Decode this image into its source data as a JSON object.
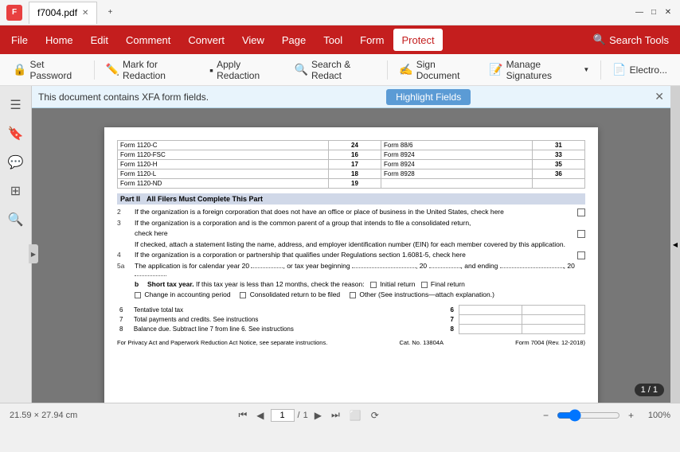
{
  "titlebar": {
    "logo": "F",
    "filename": "f7004.pdf",
    "new_tab": "+",
    "minimize": "—",
    "maximize": "□",
    "close": "✕"
  },
  "menubar": {
    "items": [
      {
        "label": "File",
        "active": false
      },
      {
        "label": "Home",
        "active": false
      },
      {
        "label": "Edit",
        "active": false
      },
      {
        "label": "Comment",
        "active": false
      },
      {
        "label": "Convert",
        "active": false
      },
      {
        "label": "View",
        "active": false
      },
      {
        "label": "Page",
        "active": false
      },
      {
        "label": "Tool",
        "active": false
      },
      {
        "label": "Form",
        "active": false
      },
      {
        "label": "Protect",
        "active": true
      }
    ],
    "search_tools": "Search Tools"
  },
  "toolbar": {
    "set_password": "Set Password",
    "mark_redaction": "Mark for Redaction",
    "apply_redaction": "Apply Redaction",
    "search_redact": "Search & Redact",
    "sign_document": "Sign Document",
    "manage_signatures": "Manage Signatures",
    "electronic": "Electro..."
  },
  "xfa_banner": {
    "text": "This document contains XFA form fields.",
    "button": "Highlight Fields",
    "close": "✕"
  },
  "pdf": {
    "forms_table": [
      {
        "left_name": "Form 1120-C",
        "left_num": "24",
        "right_name": "Form 88/6",
        "right_num": "31"
      },
      {
        "left_name": "Form 1120-FSC",
        "left_num": "16",
        "right_name": "Form 8924",
        "right_num": "33"
      },
      {
        "left_name": "Form 1120-H",
        "left_num": "17",
        "right_name": "Form 8924",
        "right_num": "35"
      },
      {
        "left_name": "Form 1120-L",
        "left_num": "18",
        "right_name": "Form 8928",
        "right_num": "36"
      },
      {
        "left_name": "Form 1120-ND",
        "left_num": "19",
        "right_name": "",
        "right_num": ""
      }
    ],
    "part2_label": "Part II",
    "part2_title": "All Filers Must Complete This Part",
    "fields": [
      {
        "num": "2",
        "sub": "",
        "text": "If the organization is a foreign corporation that does not have an office or place of business in the United States,  check here",
        "has_checkbox": true
      },
      {
        "num": "3",
        "sub": "",
        "text": "If the organization is a corporation and is the common parent of a group that intends to file a consolidated return,",
        "text2": "check here",
        "has_checkbox": true
      },
      {
        "num": "",
        "sub": "",
        "text": "If checked, attach a statement listing the name, address, and employer identification number (EIN) for each member  covered by this application."
      },
      {
        "num": "4",
        "sub": "",
        "text": "If the organization is a corporation or partnership that qualifies under Regulations section 1.6081-5, check here",
        "has_checkbox": true
      },
      {
        "num": "5a",
        "sub": "",
        "text": "The application is for calendar year 20",
        "mid": ", or tax year beginning",
        "end": ", 20     , and ending",
        "end2": ", 20"
      },
      {
        "num": "",
        "sub": "b",
        "text": "Short tax year. If this tax year is less than 12 months, check the reason:",
        "items": [
          "Initial return",
          "Final return"
        ]
      },
      {
        "num": "",
        "sub": "",
        "text": "Change in accounting period",
        "text2": "Consolidated return to be filed",
        "text3": "Other (See instructions—attach explanation.)"
      }
    ],
    "line6_label": "6",
    "line6_text": "Tentative total tax",
    "line7_label": "7",
    "line7_text": "Total payments and credits. See instructions",
    "line8_label": "8",
    "line8_text": "Balance due. Subtract line 7 from line 6. See instructions",
    "footer_left": "For Privacy Act and Paperwork Reduction Act Notice, see separate instructions.",
    "footer_cat": "Cat. No. 13804A",
    "footer_form": "Form 7004 (Rev. 12-2018)"
  },
  "statusbar": {
    "dimensions": "21.59 × 27.94 cm",
    "current_page": "1",
    "total_pages": "1",
    "page_display": "1 / 1",
    "zoom_percent": "100%",
    "page_badge": "1 / 1"
  }
}
